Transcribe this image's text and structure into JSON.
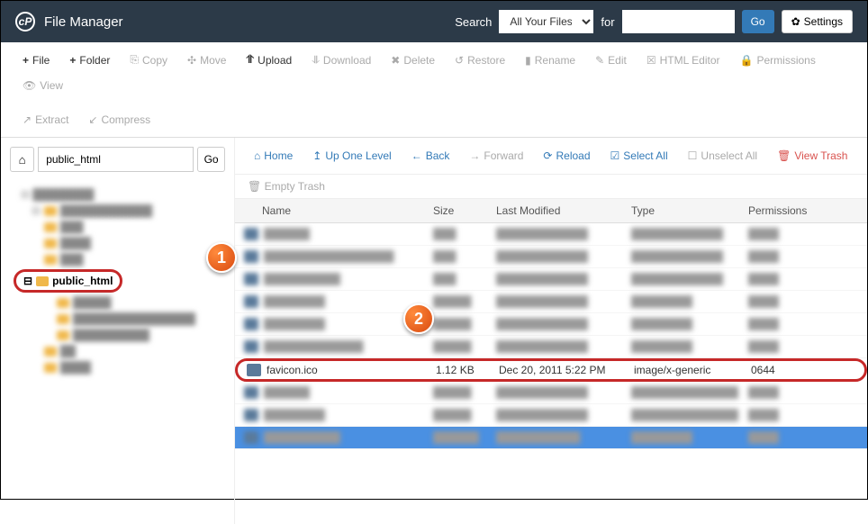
{
  "header": {
    "title": "File Manager",
    "searchLabel": "Search",
    "forLabel": "for",
    "searchScope": "All Your Files",
    "goLabel": "Go",
    "settingsLabel": "Settings"
  },
  "toolbar": {
    "file": "File",
    "folder": "Folder",
    "copy": "Copy",
    "move": "Move",
    "upload": "Upload",
    "download": "Download",
    "delete": "Delete",
    "restore": "Restore",
    "rename": "Rename",
    "edit": "Edit",
    "htmlEditor": "HTML Editor",
    "permissions": "Permissions",
    "view": "View",
    "extract": "Extract",
    "compress": "Compress"
  },
  "pathbar": {
    "value": "public_html",
    "go": "Go"
  },
  "tree": {
    "highlighted": "public_html"
  },
  "nav": {
    "home": "Home",
    "upOne": "Up One Level",
    "back": "Back",
    "forward": "Forward",
    "reload": "Reload",
    "selectAll": "Select All",
    "unselectAll": "Unselect All",
    "viewTrash": "View Trash",
    "emptyTrash": "Empty Trash"
  },
  "columns": {
    "name": "Name",
    "size": "Size",
    "modified": "Last Modified",
    "type": "Type",
    "permissions": "Permissions"
  },
  "highlightRow": {
    "name": "favicon.ico",
    "size": "1.12 KB",
    "modified": "Dec 20, 2011 5:22 PM",
    "type": "image/x-generic",
    "perm": "0644"
  },
  "markers": {
    "one": "1",
    "two": "2"
  }
}
